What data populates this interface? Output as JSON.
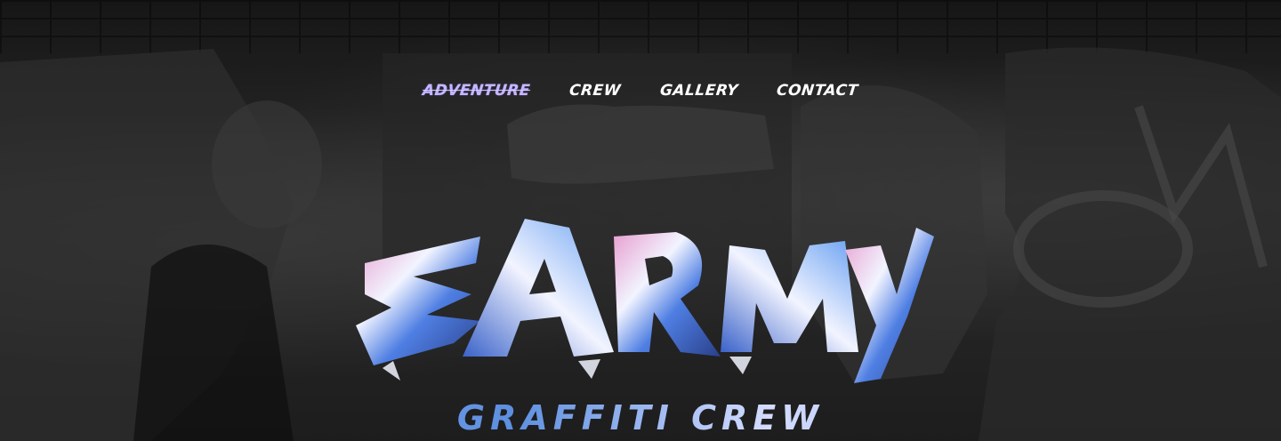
{
  "nav": {
    "items": [
      {
        "label": "ADVENTURE",
        "active": true
      },
      {
        "label": "CREW",
        "active": false
      },
      {
        "label": "GALLERY",
        "active": false
      },
      {
        "label": "CONTACT",
        "active": false
      }
    ]
  },
  "logo": {
    "text": "EARMY"
  },
  "tagline": "GRAFFITI CREW",
  "colors": {
    "background": "#1c1c1c",
    "nav_active": "#c7b6ff",
    "nav_text": "#ffffff",
    "tagline_blue": "#6fa4ea",
    "logo_blue": "#4f7fe3",
    "logo_pink": "#e79fd0",
    "logo_white": "#f2f4ff"
  }
}
